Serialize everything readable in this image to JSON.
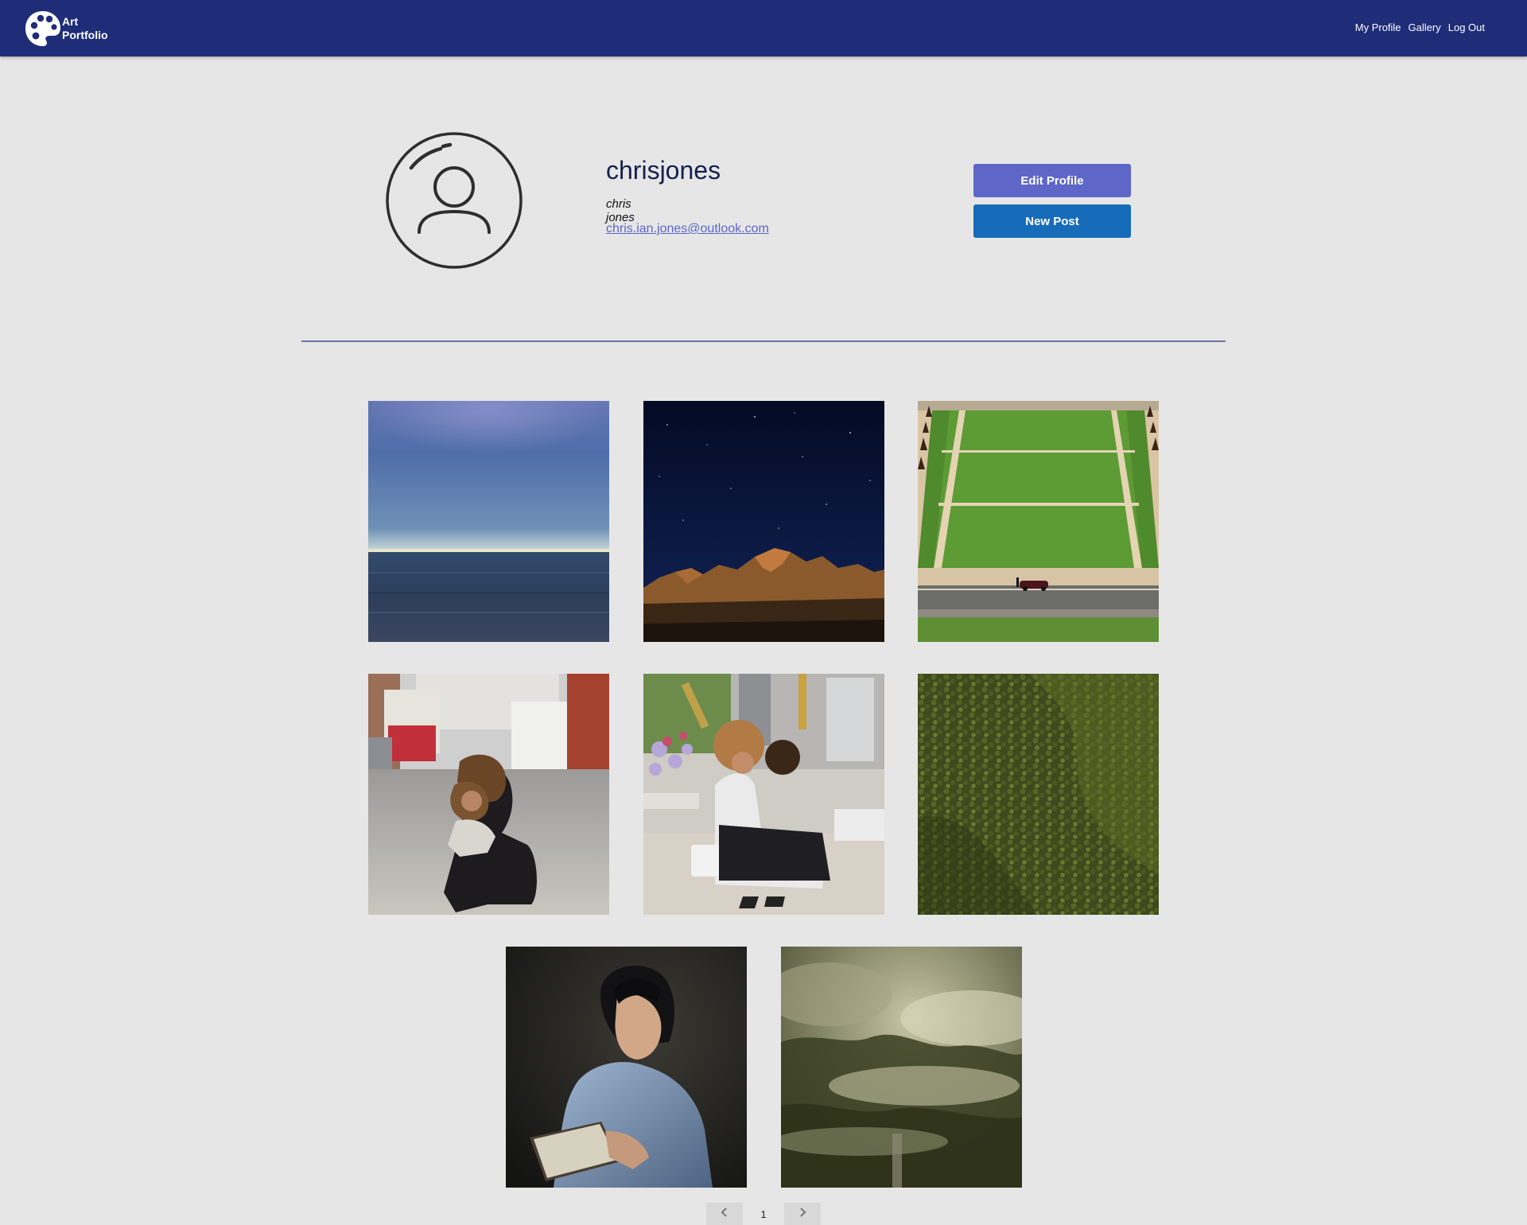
{
  "app": {
    "brand_line1": "Art",
    "brand_line2": "Portfolio",
    "logo_icon": "palette-icon",
    "nav": [
      "My Profile",
      "Gallery",
      "Log Out"
    ]
  },
  "profile": {
    "username": "chrisjones",
    "full_name": "chris jones",
    "email": "chris.ian.jones@outlook.com",
    "avatar_icon": "user-avatar-icon",
    "edit_button": "Edit Profile",
    "new_post_button": "New Post"
  },
  "gallery": {
    "images": [
      "ocean-horizon",
      "night-sky-mountains",
      "green-field-aerial",
      "mother-child-street",
      "mother-daughter-flowers",
      "forest-aerial",
      "woman-reading",
      "misty-forest"
    ]
  },
  "pagination": {
    "current_page": "1",
    "prev_icon": "chevron-left-icon",
    "next_icon": "chevron-right-icon"
  },
  "colors": {
    "navbar": "#1f2c78",
    "background": "#e6e6e6",
    "edit_button": "#5e67c7",
    "new_post_button": "#166cb8",
    "link": "#5b67c6"
  }
}
